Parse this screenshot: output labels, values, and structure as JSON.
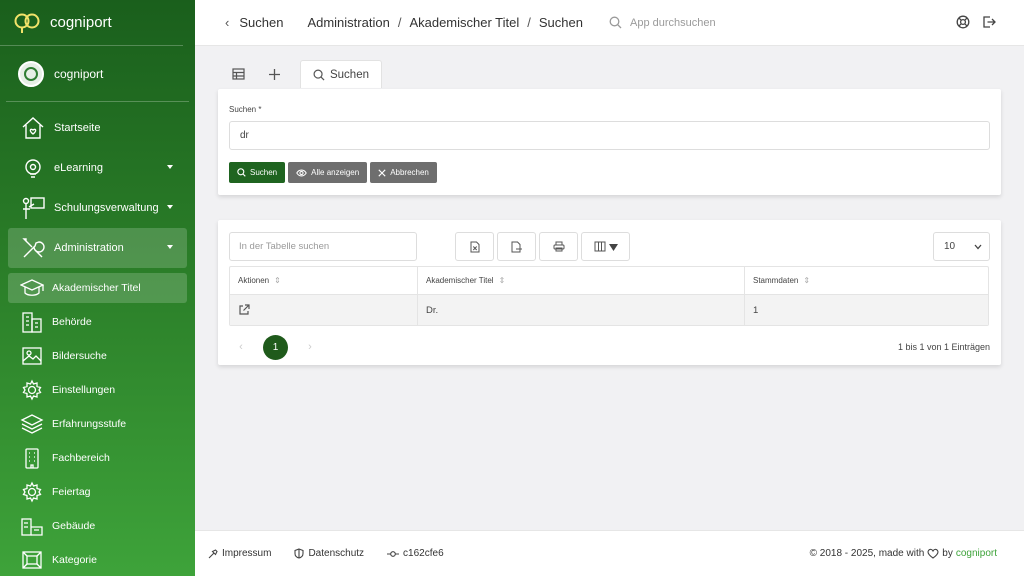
{
  "app": {
    "name": "cogniport"
  },
  "user": {
    "name": "cogniport"
  },
  "sidebar": {
    "items": [
      {
        "label": "Startseite",
        "icon": "home-heart-icon",
        "has_submenu": false
      },
      {
        "label": "eLearning",
        "icon": "lightbulb-icon",
        "has_submenu": true
      },
      {
        "label": "Schulungsverwaltung",
        "icon": "teacher-board-icon",
        "has_submenu": true
      },
      {
        "label": "Administration",
        "icon": "tools-icon",
        "has_submenu": true,
        "expanded": true
      }
    ],
    "sub_items": [
      {
        "label": "Akademischer Titel",
        "icon": "graduation-cap-icon",
        "active": true
      },
      {
        "label": "Behörde",
        "icon": "buildings-icon"
      },
      {
        "label": "Bildersuche",
        "icon": "image-icon"
      },
      {
        "label": "Einstellungen",
        "icon": "gear-icon"
      },
      {
        "label": "Erfahrungsstufe",
        "icon": "layers-icon"
      },
      {
        "label": "Fachbereich",
        "icon": "building-icon"
      },
      {
        "label": "Feiertag",
        "icon": "gear-badge-icon"
      },
      {
        "label": "Gebäude",
        "icon": "campus-icon"
      },
      {
        "label": "Kategorie",
        "icon": "frame-icon"
      }
    ]
  },
  "topbar": {
    "back_label": "Suchen",
    "breadcrumb": [
      "Administration",
      "Akademischer Titel",
      "Suchen"
    ],
    "search_placeholder": "App durchsuchen"
  },
  "tabs": {
    "active_label": "Suchen"
  },
  "search_form": {
    "label": "Suchen *",
    "value": "dr",
    "buttons": {
      "search": "Suchen",
      "show_all": "Alle anzeigen",
      "cancel": "Abbrechen"
    }
  },
  "table": {
    "search_placeholder": "In der Tabelle suchen",
    "page_size": "10",
    "columns": [
      "Aktionen",
      "Akademischer Titel",
      "Stammdaten"
    ],
    "rows": [
      {
        "title": "Dr.",
        "stammdaten": "1"
      }
    ],
    "current_page": "1",
    "info": "1 bis 1 von 1 Einträgen"
  },
  "footer": {
    "impressum": "Impressum",
    "datenschutz": "Datenschutz",
    "version": "c162cfe6",
    "copyright": "© 2018 - 2025, made with",
    "by": "by",
    "brand": "cogniport"
  },
  "colors": {
    "primary": "#1f6420",
    "sidebar_top": "#1a5f1c",
    "sidebar_bottom": "#3ea33a",
    "secondary_button": "#6e6e6e"
  }
}
